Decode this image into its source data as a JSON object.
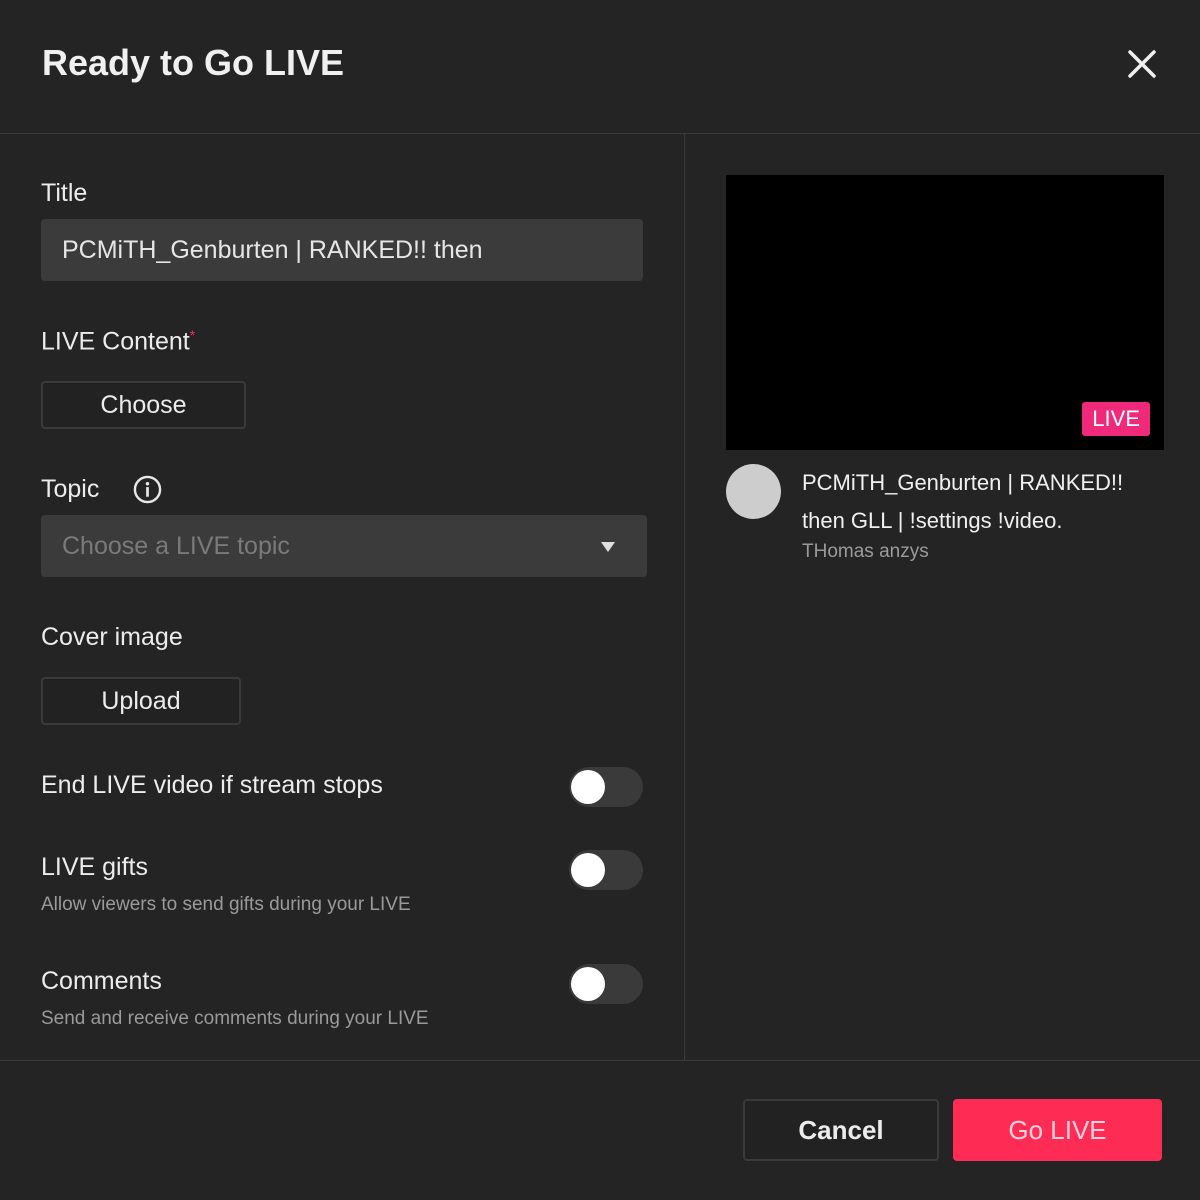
{
  "dialog": {
    "title": "Ready to Go LIVE",
    "close_icon": "close-icon"
  },
  "form": {
    "title_label": "Title",
    "title_value": "PCMiTH_Genburten | RANKED!! then",
    "content_label": "LIVE Content",
    "required_mark": "*",
    "choose_button": "Choose",
    "topic_label": "Topic",
    "topic_placeholder": "Choose a LIVE topic",
    "cover_label": "Cover image",
    "upload_button": "Upload",
    "end_live_label": "End LIVE video if stream stops",
    "end_live_on": false,
    "gifts_label": "LIVE gifts",
    "gifts_desc": "Allow viewers to send gifts during your LIVE",
    "gifts_on": false,
    "comments_label": "Comments",
    "comments_desc": "Send and receive comments during your LIVE",
    "comments_on": false
  },
  "preview": {
    "badge": "LIVE",
    "stream_title": "PCMiTH_Genburten | RANKED!! then GLL | !settings !video.",
    "username": "THomas anzys"
  },
  "footer": {
    "cancel": "Cancel",
    "go_live": "Go LIVE"
  },
  "colors": {
    "accent": "#fe2c55",
    "live_badge": "#f0297a",
    "background": "#242424"
  }
}
